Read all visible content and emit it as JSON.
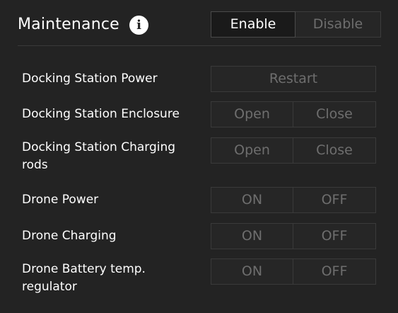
{
  "header": {
    "title": "Maintenance",
    "info_icon_glyph": "i",
    "enable_label": "Enable",
    "disable_label": "Disable"
  },
  "rows": [
    {
      "label": "Docking Station Power",
      "buttons": [
        "Restart"
      ]
    },
    {
      "label": "Docking Station Enclosure",
      "buttons": [
        "Open",
        "Close"
      ]
    },
    {
      "label_line1": "Docking Station Charging",
      "label_line2": "rods",
      "buttons": [
        "Open",
        "Close"
      ]
    },
    {
      "label": "Drone Power",
      "buttons": [
        "ON",
        "OFF"
      ]
    },
    {
      "label": "Drone Charging",
      "buttons": [
        "ON",
        "OFF"
      ]
    },
    {
      "label_line1": "Drone Battery temp.",
      "label_line2": "regulator",
      "buttons": [
        "ON",
        "OFF"
      ]
    }
  ],
  "colors": {
    "background": "#232323",
    "text": "#ffffff",
    "disabled_text": "#6e6e6e",
    "border": "#3a3a3a"
  }
}
